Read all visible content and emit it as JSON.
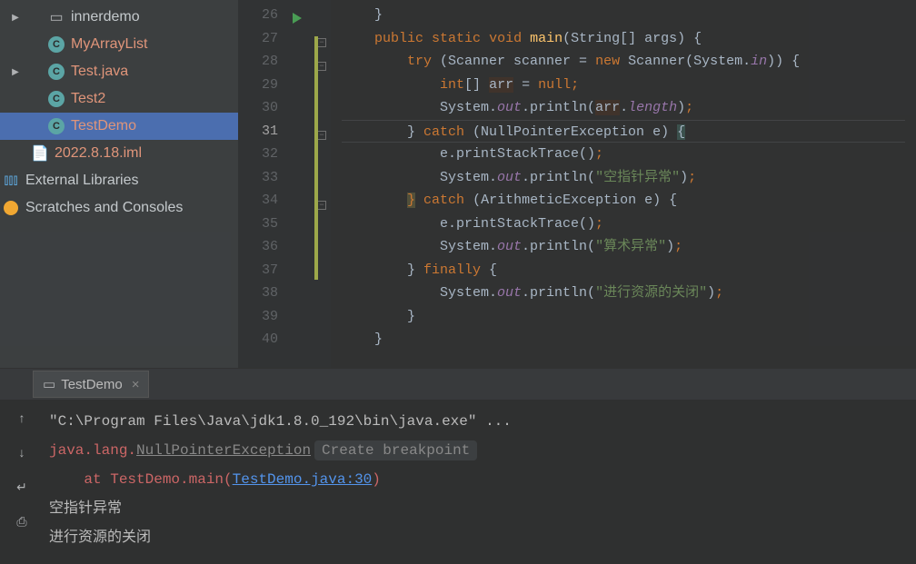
{
  "sidebar": {
    "items": [
      {
        "label": "innerdemo"
      },
      {
        "label": "MyArrayList"
      },
      {
        "label": "Test.java"
      },
      {
        "label": "Test2"
      },
      {
        "label": "TestDemo"
      },
      {
        "label": "2022.8.18.iml"
      }
    ],
    "ext_lib": "External Libraries",
    "scratch": "Scratches and Consoles"
  },
  "editor": {
    "line_start": 26,
    "line_end": 40,
    "current_line": 31,
    "lines": [
      {
        "n": 26,
        "tokens": [
          {
            "t": "    }",
            "c": ""
          }
        ]
      },
      {
        "n": 27,
        "tokens": [
          {
            "t": "    ",
            "c": ""
          },
          {
            "t": "public",
            "c": "kw"
          },
          {
            "t": " ",
            "c": ""
          },
          {
            "t": "static",
            "c": "kw"
          },
          {
            "t": " ",
            "c": ""
          },
          {
            "t": "void",
            "c": "kw"
          },
          {
            "t": " ",
            "c": ""
          },
          {
            "t": "main",
            "c": "method"
          },
          {
            "t": "(String[] args) {",
            "c": ""
          }
        ]
      },
      {
        "n": 28,
        "tokens": [
          {
            "t": "        ",
            "c": ""
          },
          {
            "t": "try",
            "c": "kw"
          },
          {
            "t": " (Scanner scanner = ",
            "c": ""
          },
          {
            "t": "new",
            "c": "kw"
          },
          {
            "t": " Scanner(System.",
            "c": ""
          },
          {
            "t": "in",
            "c": "field"
          },
          {
            "t": ")) {",
            "c": ""
          }
        ]
      },
      {
        "n": 29,
        "tokens": [
          {
            "t": "            ",
            "c": ""
          },
          {
            "t": "int",
            "c": "kw"
          },
          {
            "t": "[] ",
            "c": ""
          },
          {
            "t": "arr",
            "c": "hl-var"
          },
          {
            "t": " = ",
            "c": ""
          },
          {
            "t": "null",
            "c": "kw"
          },
          {
            "t": ";",
            "c": "kw"
          }
        ]
      },
      {
        "n": 30,
        "tokens": [
          {
            "t": "            System.",
            "c": ""
          },
          {
            "t": "out",
            "c": "field"
          },
          {
            "t": ".println(",
            "c": ""
          },
          {
            "t": "arr",
            "c": "hl-var"
          },
          {
            "t": ".",
            "c": ""
          },
          {
            "t": "length",
            "c": "field"
          },
          {
            "t": ")",
            "c": ""
          },
          {
            "t": ";",
            "c": "kw"
          }
        ]
      },
      {
        "n": 31,
        "tokens": [
          {
            "t": "        } ",
            "c": ""
          },
          {
            "t": "catch",
            "c": "kw"
          },
          {
            "t": " (NullPointerException e) ",
            "c": ""
          },
          {
            "t": "{",
            "c": "brace-match"
          }
        ]
      },
      {
        "n": 32,
        "tokens": [
          {
            "t": "            e.printStackTrace()",
            "c": ""
          },
          {
            "t": ";",
            "c": "kw"
          }
        ]
      },
      {
        "n": 33,
        "tokens": [
          {
            "t": "            System.",
            "c": ""
          },
          {
            "t": "out",
            "c": "field"
          },
          {
            "t": ".println(",
            "c": ""
          },
          {
            "t": "\"空指针异常\"",
            "c": "str"
          },
          {
            "t": ")",
            "c": ""
          },
          {
            "t": ";",
            "c": "kw"
          }
        ]
      },
      {
        "n": 34,
        "tokens": [
          {
            "t": "        ",
            "c": ""
          },
          {
            "t": "}",
            "c": "brace-warn"
          },
          {
            "t": " ",
            "c": ""
          },
          {
            "t": "catch",
            "c": "kw"
          },
          {
            "t": " (ArithmeticException e) {",
            "c": ""
          }
        ]
      },
      {
        "n": 35,
        "tokens": [
          {
            "t": "            e.printStackTrace()",
            "c": ""
          },
          {
            "t": ";",
            "c": "kw"
          }
        ]
      },
      {
        "n": 36,
        "tokens": [
          {
            "t": "            System.",
            "c": ""
          },
          {
            "t": "out",
            "c": "field"
          },
          {
            "t": ".println(",
            "c": ""
          },
          {
            "t": "\"算术异常\"",
            "c": "str"
          },
          {
            "t": ")",
            "c": ""
          },
          {
            "t": ";",
            "c": "kw"
          }
        ]
      },
      {
        "n": 37,
        "tokens": [
          {
            "t": "        } ",
            "c": ""
          },
          {
            "t": "finally",
            "c": "kw"
          },
          {
            "t": " {",
            "c": ""
          }
        ]
      },
      {
        "n": 38,
        "tokens": [
          {
            "t": "            System.",
            "c": ""
          },
          {
            "t": "out",
            "c": "field"
          },
          {
            "t": ".println(",
            "c": ""
          },
          {
            "t": "\"进行资源的关闭\"",
            "c": "str"
          },
          {
            "t": ")",
            "c": ""
          },
          {
            "t": ";",
            "c": "kw"
          }
        ]
      },
      {
        "n": 39,
        "tokens": [
          {
            "t": "        }",
            "c": ""
          }
        ]
      },
      {
        "n": 40,
        "tokens": [
          {
            "t": "    }",
            "c": ""
          }
        ]
      }
    ]
  },
  "run_tab": {
    "label": "TestDemo"
  },
  "console": {
    "line1": "\"C:\\Program Files\\Java\\jdk1.8.0_192\\bin\\java.exe\" ...",
    "exc_prefix": "java.lang.",
    "exc_name": "NullPointerException",
    "hint": "Create breakpoint",
    "at": "    at TestDemo.main(",
    "link": "TestDemo.java:30",
    "close_paren": ")",
    "out1": "空指针异常",
    "out2": "进行资源的关闭"
  },
  "icons": {
    "class_c": "C",
    "close_x": "×",
    "up": "↑",
    "down": "↓",
    "wrap": "↵"
  }
}
